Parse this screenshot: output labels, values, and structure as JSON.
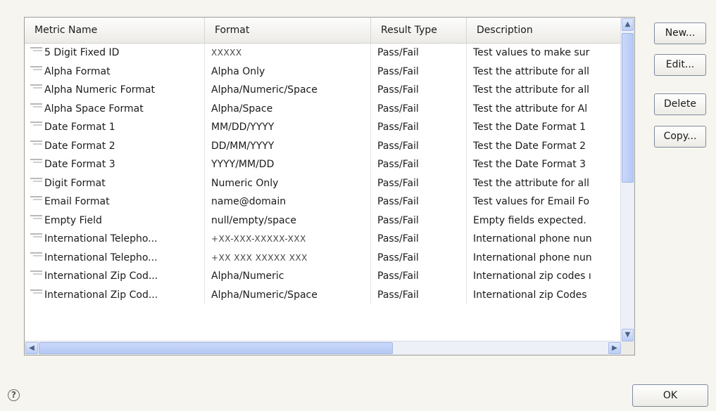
{
  "table": {
    "columns": [
      "Metric Name",
      "Format",
      "Result Type",
      "Description"
    ],
    "rows": [
      {
        "name": "5 Digit Fixed ID",
        "format": "XXXXX",
        "result": "Pass/Fail",
        "description": "Test values to make sur"
      },
      {
        "name": "Alpha Format",
        "format": "Alpha Only",
        "result": "Pass/Fail",
        "description": "Test the attribute for all"
      },
      {
        "name": "Alpha Numeric Format",
        "format": "Alpha/Numeric/Space",
        "result": "Pass/Fail",
        "description": "Test the attribute for all"
      },
      {
        "name": "Alpha Space Format",
        "format": "Alpha/Space",
        "result": "Pass/Fail",
        "description": "Test the attribute for Al"
      },
      {
        "name": "Date Format 1",
        "format": "MM/DD/YYYY",
        "result": "Pass/Fail",
        "description": "Test the Date Format 1"
      },
      {
        "name": "Date Format 2",
        "format": "DD/MM/YYYY",
        "result": "Pass/Fail",
        "description": "Test the Date Format 2"
      },
      {
        "name": "Date Format 3",
        "format": "YYYY/MM/DD",
        "result": "Pass/Fail",
        "description": "Test the Date Format 3"
      },
      {
        "name": "Digit Format",
        "format": "Numeric Only",
        "result": "Pass/Fail",
        "description": "Test the attribute for all"
      },
      {
        "name": "Email Format",
        "format": "name@domain",
        "result": "Pass/Fail",
        "description": "Test values for Email Fo"
      },
      {
        "name": "Empty Field",
        "format": "null/empty/space",
        "result": "Pass/Fail",
        "description": "Empty fields expected."
      },
      {
        "name": "International Telepho...",
        "format": "+XX-XXX-XXXXX-XXX",
        "result": "Pass/Fail",
        "description": "International phone nun"
      },
      {
        "name": "International Telepho...",
        "format": "+XX XXX XXXXX XXX",
        "result": "Pass/Fail",
        "description": "International phone nun"
      },
      {
        "name": "International Zip Cod...",
        "format": "Alpha/Numeric",
        "result": "Pass/Fail",
        "description": "International zip codes ı"
      },
      {
        "name": "International Zip Cod...",
        "format": "Alpha/Numeric/Space",
        "result": "Pass/Fail",
        "description": "International zip Codes"
      }
    ]
  },
  "buttons": {
    "new": "New...",
    "edit": "Edit...",
    "delete": "Delete",
    "copy": "Copy...",
    "ok": "OK"
  },
  "help": {
    "glyph": "?"
  },
  "scroll_glyphs": {
    "up": "▲",
    "down": "▼",
    "left": "◀",
    "right": "▶"
  }
}
